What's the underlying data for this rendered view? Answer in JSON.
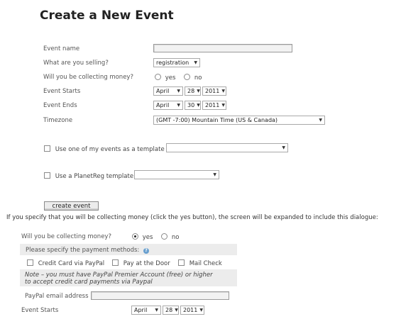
{
  "page": {
    "title": "Create a New Event"
  },
  "form": {
    "event_name_label": "Event name",
    "selling_label": "What are you selling?",
    "selling_value": "registration",
    "collecting_label": "Will you be collecting money?",
    "yes_label": "yes",
    "no_label": "no",
    "starts_label": "Event Starts",
    "starts": {
      "month": "April",
      "day": "28",
      "year": "2011"
    },
    "ends_label": "Event Ends",
    "ends": {
      "month": "April",
      "day": "30",
      "year": "2011"
    },
    "timezone_label": "Timezone",
    "timezone_value": "(GMT -7:00) Mountain Time (US & Canada)",
    "template_own_label": "Use one of my events as a template",
    "template_pr_label": "Use a PlanetReg template",
    "create_button": "create event"
  },
  "explanation": "If you specify that you will be collecting money (click the yes button), the screen will be expanded to include this dialogue:",
  "expanded": {
    "collecting_label": "Will you be collecting money?",
    "yes_label": "yes",
    "no_label": "no",
    "selected": "yes",
    "payment_methods_label": "Please specify the payment methods:",
    "methods": [
      "Credit Card via PayPal",
      "Pay at the Door",
      "Mail Check"
    ],
    "note_line1": "Note – you must have PayPal Premier Account (free) or higher",
    "note_line2": "to accept credit card payments via Paypal",
    "paypal_email_label": "PayPal email address",
    "starts_label": "Event Starts",
    "starts": {
      "month": "April",
      "day": "28",
      "year": "2011"
    }
  }
}
